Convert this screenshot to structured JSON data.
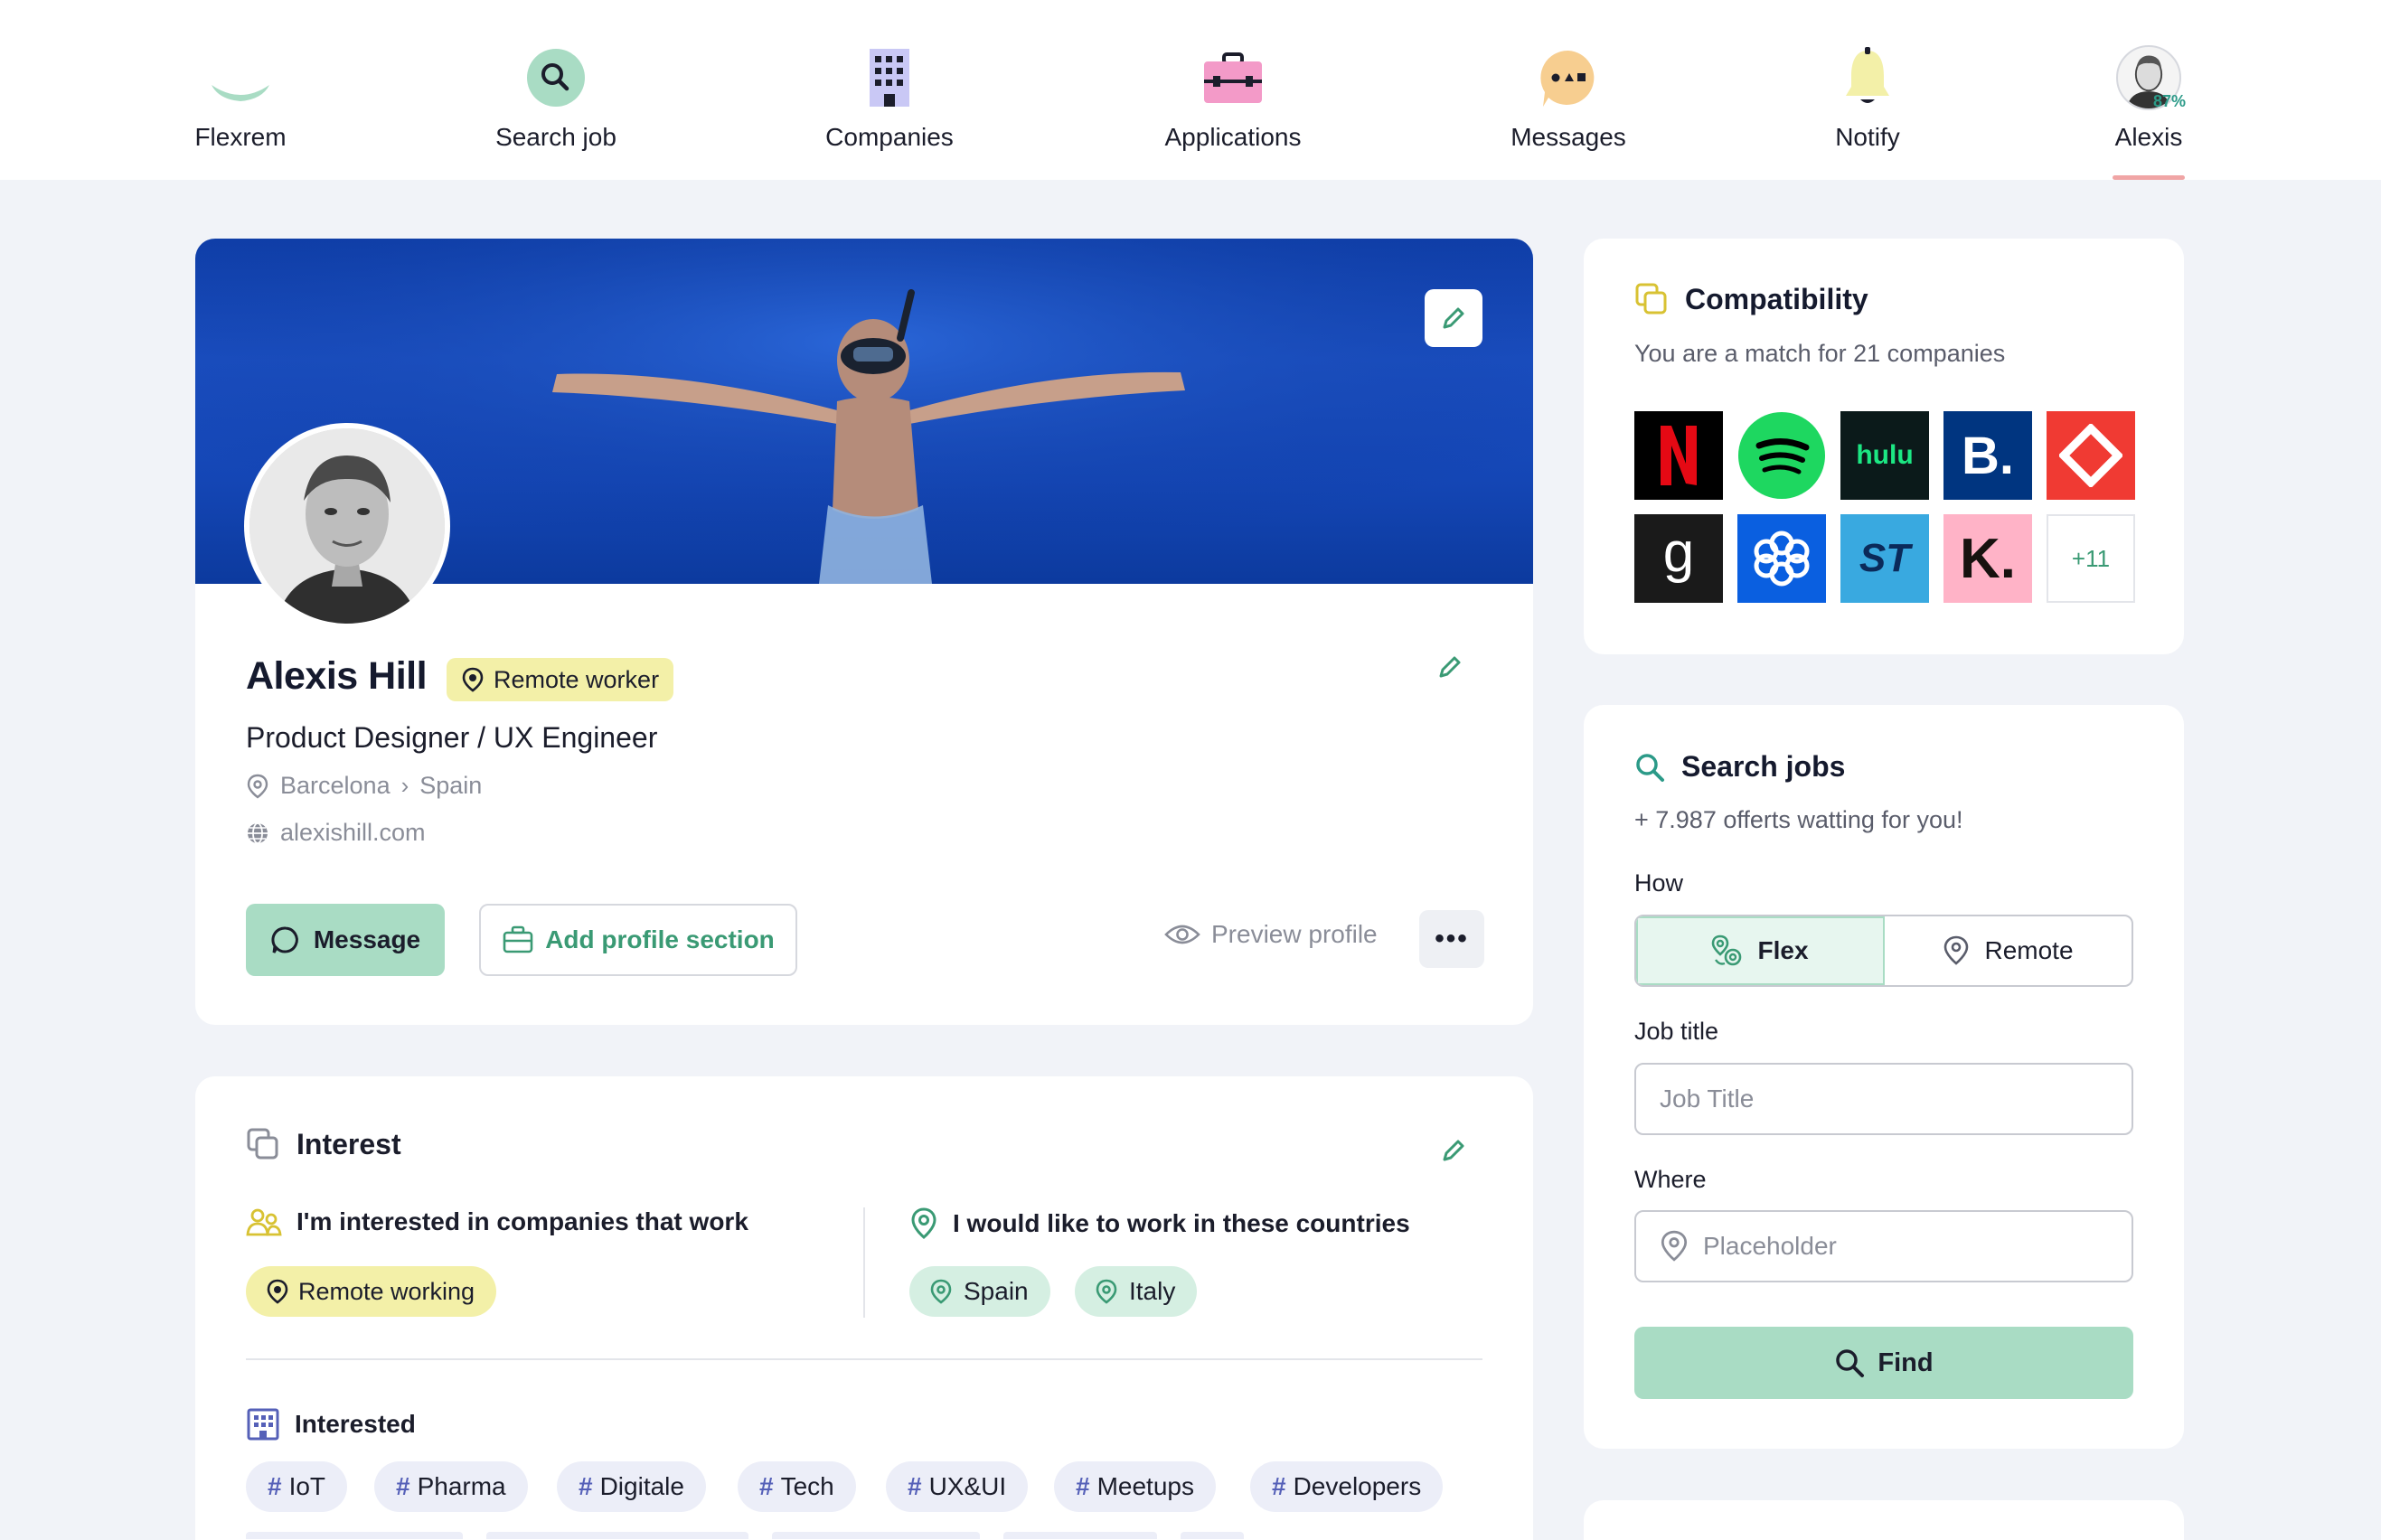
{
  "nav": {
    "brand_label": "Flexrem",
    "items": [
      {
        "label": "Search job"
      },
      {
        "label": "Companies"
      },
      {
        "label": "Applications"
      },
      {
        "label": "Messages"
      },
      {
        "label": "Notify"
      }
    ],
    "user": {
      "label": "Alexis",
      "completion": "87%"
    }
  },
  "profile": {
    "name": "Alexis Hill",
    "badge": "Remote worker",
    "role": "Product Designer / UX Engineer",
    "city": "Barcelona",
    "country": "Spain",
    "website": "alexishill.com",
    "message_label": "Message",
    "add_section_label": "Add profile section",
    "preview_label": "Preview profile",
    "more_label": "•••"
  },
  "interest": {
    "title": "Interest",
    "work_heading": "I'm interested in companies that work",
    "work_tag": "Remote working",
    "countries_heading": "I would like to work in these countries",
    "countries": [
      "Spain",
      "Italy"
    ],
    "interested_heading": "Interested",
    "tags": [
      "IoT",
      "Pharma",
      "Digitale",
      "Tech",
      "UX&UI",
      "Meetups",
      "Developers"
    ]
  },
  "compatibility": {
    "title": "Compatibility",
    "subtitle": "You are a match for 21 companies",
    "logos": [
      {
        "name": "netflix",
        "text": "N",
        "bg": "#000000",
        "fg": "#e50914"
      },
      {
        "name": "spotify",
        "text": "",
        "bg": "#ffffff",
        "fg": "#1ed760"
      },
      {
        "name": "hulu",
        "text": "hulu",
        "bg": "#0b1a1a",
        "fg": "#1ce783"
      },
      {
        "name": "booking",
        "text": "B.",
        "bg": "#003580",
        "fg": "#ffffff"
      },
      {
        "name": "diamond",
        "text": "",
        "bg": "#f03a33",
        "fg": "#ffffff"
      },
      {
        "name": "goodreads",
        "text": "g",
        "bg": "#1a1a1a",
        "fg": "#ffffff"
      },
      {
        "name": "flower",
        "text": "",
        "bg": "#0a5fe0",
        "fg": "#ffffff"
      },
      {
        "name": "st",
        "text": "ST",
        "bg": "#39a9e0",
        "fg": "#0b2a5a"
      },
      {
        "name": "klarna",
        "text": "K.",
        "bg": "#ffb3c7",
        "fg": "#17120f"
      }
    ],
    "more": "+11"
  },
  "search": {
    "title": "Search jobs",
    "subtitle": "+ 7.987 offerts watting for you!",
    "how_label": "How",
    "flex_label": "Flex",
    "remote_label": "Remote",
    "job_title_label": "Job title",
    "job_title_placeholder": "Job Title",
    "where_label": "Where",
    "where_placeholder": "Placeholder",
    "find_label": "Find"
  },
  "colors": {
    "accent_green": "#a9dcc4",
    "accent_text_green": "#3a9a74",
    "badge_yellow": "#f3f0a8",
    "tag_bg": "#eceef8"
  }
}
